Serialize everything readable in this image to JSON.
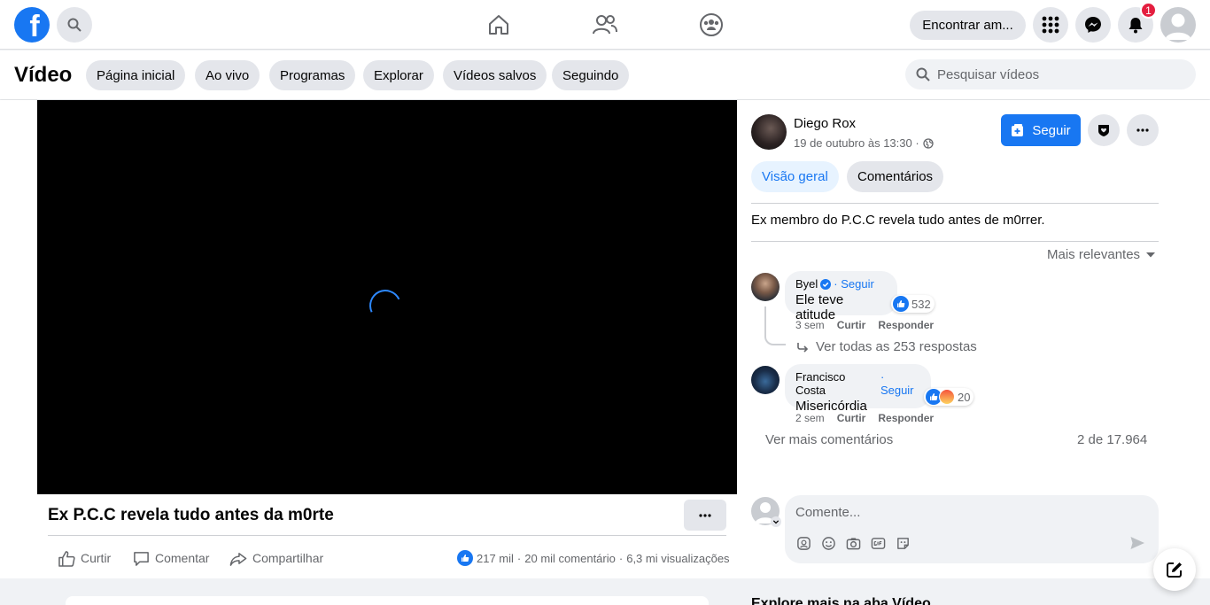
{
  "topbar": {
    "logo_letter": "f",
    "find_friends": "Encontrar am...",
    "notification_count": "1"
  },
  "video_header": {
    "title": "Vídeo",
    "chips": [
      "Página inicial",
      "Ao vivo",
      "Programas",
      "Explorar",
      "Vídeos salvos",
      "Seguindo"
    ],
    "search_placeholder": "Pesquisar vídeos"
  },
  "post": {
    "title": "Ex P.C.C revela tudo antes da m0rte",
    "actions": {
      "like": "Curtir",
      "comment": "Comentar",
      "share": "Compartilhar"
    },
    "stats": {
      "likes": "217 mil",
      "comments": "20 mil comentário",
      "views": "6,3 mi visualizações"
    }
  },
  "author": {
    "name": "Diego Rox",
    "date": "19 de outubro às 13:30 ·",
    "follow_label": "Seguir"
  },
  "tabs": {
    "overview": "Visão geral",
    "comments": "Comentários"
  },
  "description": "Ex membro do P.C.C revela tudo antes de m0rrer.",
  "sort_label": "Mais relevantes",
  "comments": [
    {
      "name": "Byel",
      "follow": "· Seguir",
      "text": "Ele teve atitude",
      "reactions": "532",
      "time": "3 sem",
      "like": "Curtir",
      "reply": "Responder"
    },
    {
      "name": "Francisco Costa",
      "follow": "· Seguir",
      "text": "Misericórdia",
      "reactions": "20",
      "time": "2 sem",
      "like": "Curtir",
      "reply": "Responder"
    }
  ],
  "replies_link": "Ver todas as 253 respostas",
  "more_comments": "Ver mais comentários",
  "comment_count": "2 de 17.964",
  "comment_placeholder": "Comente...",
  "explore_heading": "Explore mais na aba Vídeo",
  "colors": {
    "brand": "#1877f2",
    "badge": "#e41e3f"
  }
}
